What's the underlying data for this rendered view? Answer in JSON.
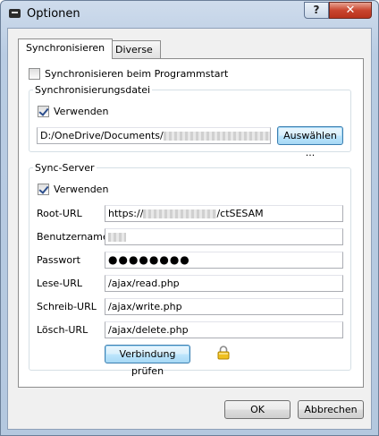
{
  "window": {
    "title": "Optionen",
    "help_label": "?",
    "close_label": "✕"
  },
  "tabs": [
    {
      "label": "Synchronisieren",
      "active": true
    },
    {
      "label": "Diverse",
      "active": false
    }
  ],
  "sync_on_start": {
    "label": "Synchronisieren beim Programmstart",
    "checked": false
  },
  "sync_file": {
    "group_title": "Synchronisierungsdatei",
    "use_label": "Verwenden",
    "use_checked": true,
    "path_value": "D:/OneDrive/Documents/",
    "browse_label": "Auswählen ..."
  },
  "sync_server": {
    "group_title": "Sync-Server",
    "use_label": "Verwenden",
    "use_checked": true,
    "root_url_label": "Root-URL",
    "root_url_prefix": "https://",
    "root_url_suffix": "/ctSESAM",
    "username_label": "Benutzername",
    "password_label": "Passwort",
    "password_value": "●●●●●●●●",
    "read_url_label": "Lese-URL",
    "read_url_value": "/ajax/read.php",
    "write_url_label": "Schreib-URL",
    "write_url_value": "/ajax/write.php",
    "delete_url_label": "Lösch-URL",
    "delete_url_value": "/ajax/delete.php",
    "verify_label": "Verbindung prüfen",
    "lock_icon": "lock-icon"
  },
  "footer": {
    "ok_label": "OK",
    "cancel_label": "Abbrechen"
  }
}
